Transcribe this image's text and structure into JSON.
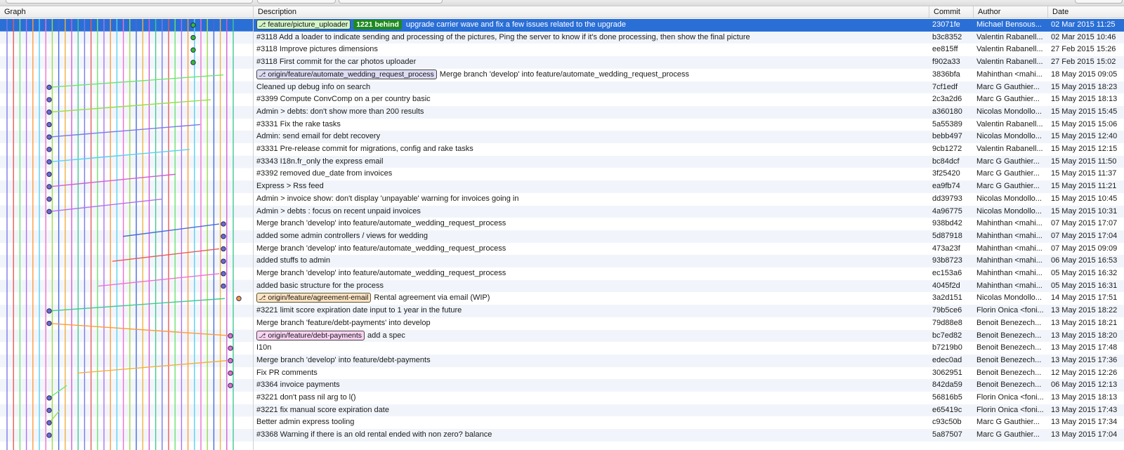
{
  "columns": {
    "graph": "Graph",
    "description": "Description",
    "commit": "Commit",
    "author": "Author",
    "date": "Date"
  },
  "colors": {
    "selected_row": "#2a6fd6",
    "behind_badge": "#1f8a1f",
    "lanes": [
      "#7a7ae8",
      "#e85a5a",
      "#6fe36f",
      "#b070f0",
      "#ff9a3c",
      "#5ad0f0",
      "#f070d0",
      "#9adc4a",
      "#4a6ad8",
      "#f0b040",
      "#d060d0",
      "#40c890"
    ]
  },
  "commits": [
    {
      "refs": [
        {
          "label": "feature/picture_uploader",
          "style": "green"
        }
      ],
      "badge": "1221 behind",
      "message": "upgrade carrier wave and fix a few issues related to the upgrade",
      "hash": "23071fe",
      "author": "Michael Bensous...",
      "date": "02 Mar 2015 11:25",
      "selected": true
    },
    {
      "refs": [],
      "message": "#3118 Add a loader to indicate sending and processing of the pictures, Ping the server to know if it's done processing, then show the final picture",
      "hash": "b3c8352",
      "author": "Valentin Rabanell...",
      "date": "02 Mar 2015 10:46"
    },
    {
      "refs": [],
      "message": "#3118 Improve pictures dimensions",
      "hash": "ee815ff",
      "author": "Valentin Rabanell...",
      "date": "27 Feb 2015 15:26"
    },
    {
      "refs": [],
      "message": "#3118 First commit for the car photos uploader",
      "hash": "f902a33",
      "author": "Valentin Rabanell...",
      "date": "27 Feb 2015 15:02"
    },
    {
      "refs": [
        {
          "label": "origin/feature/automate_wedding_request_process",
          "style": "purple"
        }
      ],
      "message": "Merge branch 'develop' into feature/automate_wedding_request_process",
      "hash": "3836bfa",
      "author": "Mahinthan <mahi...",
      "date": "18 May 2015 09:05"
    },
    {
      "refs": [],
      "message": "Cleaned up debug info on search",
      "hash": "7cf1edf",
      "author": "Marc G Gauthier...",
      "date": "15 May 2015 18:23"
    },
    {
      "refs": [],
      "message": "#3399 Compute ConvComp on a per country basic",
      "hash": "2c3a2d6",
      "author": "Marc G Gauthier...",
      "date": "15 May 2015 18:13"
    },
    {
      "refs": [],
      "message": "Admin > debts: don't show more than 200 results",
      "hash": "a360180",
      "author": "Nicolas Mondollo...",
      "date": "15 May 2015 15:45"
    },
    {
      "refs": [],
      "message": "#3331 Fix the rake tasks",
      "hash": "5a55389",
      "author": "Valentin Rabanell...",
      "date": "15 May 2015 15:06"
    },
    {
      "refs": [],
      "message": "Admin: send email for debt recovery",
      "hash": "bebb497",
      "author": "Nicolas Mondollo...",
      "date": "15 May 2015 12:40"
    },
    {
      "refs": [],
      "message": "#3331 Pre-release commit for migrations, config and rake tasks",
      "hash": "9cb1272",
      "author": "Valentin Rabanell...",
      "date": "15 May 2015 12:15"
    },
    {
      "refs": [],
      "message": "#3343 I18n.fr_only the express email",
      "hash": "bc84dcf",
      "author": "Marc G Gauthier...",
      "date": "15 May 2015 11:50"
    },
    {
      "refs": [],
      "message": "#3392 removed due_date from invoices",
      "hash": "3f25420",
      "author": "Marc G Gauthier...",
      "date": "15 May 2015 11:37"
    },
    {
      "refs": [],
      "message": "Express > Rss feed",
      "hash": "ea9fb74",
      "author": "Marc G Gauthier...",
      "date": "15 May 2015 11:21"
    },
    {
      "refs": [],
      "message": "Admin > invoice show: don't display 'unpayable' warning for invoices going in",
      "hash": "dd39793",
      "author": "Nicolas Mondollo...",
      "date": "15 May 2015 10:45"
    },
    {
      "refs": [],
      "message": "Admin > debts : focus on recent unpaid invoices",
      "hash": "4a96775",
      "author": "Nicolas Mondollo...",
      "date": "15 May 2015 10:31"
    },
    {
      "refs": [],
      "message": "Merge branch 'develop' into feature/automate_wedding_request_process",
      "hash": "938bd42",
      "author": "Mahinthan <mahi...",
      "date": "07 May 2015 17:07"
    },
    {
      "refs": [],
      "message": "added some admin controllers / views for wedding",
      "hash": "5d87918",
      "author": "Mahinthan <mahi...",
      "date": "07 May 2015 17:04"
    },
    {
      "refs": [],
      "message": "Merge branch 'develop' into feature/automate_wedding_request_process",
      "hash": "473a23f",
      "author": "Mahinthan <mahi...",
      "date": "07 May 2015 09:09"
    },
    {
      "refs": [],
      "message": "added stuffs to admin",
      "hash": "93b8723",
      "author": "Mahinthan <mahi...",
      "date": "06 May 2015 16:53"
    },
    {
      "refs": [],
      "message": "Merge branch 'develop' into feature/automate_wedding_request_process",
      "hash": "ec153a6",
      "author": "Mahinthan <mahi...",
      "date": "05 May 2015 16:32"
    },
    {
      "refs": [],
      "message": "added basic structure for the process",
      "hash": "4045f2d",
      "author": "Mahinthan <mahi...",
      "date": "05 May 2015 16:31"
    },
    {
      "refs": [
        {
          "label": "origin/feature/agreement-email",
          "style": "orange"
        }
      ],
      "message": "Rental agreement via email (WIP)",
      "hash": "3a2d151",
      "author": "Nicolas Mondollo...",
      "date": "14 May 2015 17:51"
    },
    {
      "refs": [],
      "message": "#3221 limit score expiration date input to 1 year in the future",
      "hash": "79b5ce6",
      "author": "Florin Onica <foni...",
      "date": "13 May 2015 18:22"
    },
    {
      "refs": [],
      "message": "Merge branch 'feature/debt-payments' into develop",
      "hash": "79d88e8",
      "author": "Benoit Benezech...",
      "date": "13 May 2015 18:21"
    },
    {
      "refs": [
        {
          "label": "origin/feature/debt-payments",
          "style": "pink"
        }
      ],
      "message": "add a spec",
      "hash": "bc7ed82",
      "author": "Benoit Benezech...",
      "date": "13 May 2015 18:20"
    },
    {
      "refs": [],
      "message": "I10n",
      "hash": "b7219b0",
      "author": "Benoit Benezech...",
      "date": "13 May 2015 17:48"
    },
    {
      "refs": [],
      "message": "Merge branch 'develop' into feature/debt-payments",
      "hash": "edec0ad",
      "author": "Benoit Benezech...",
      "date": "13 May 2015 17:36"
    },
    {
      "refs": [],
      "message": "Fix PR comments",
      "hash": "3062951",
      "author": "Benoit Benezech...",
      "date": "12 May 2015 12:26"
    },
    {
      "refs": [],
      "message": "#3364 invoice payments",
      "hash": "842da59",
      "author": "Benoit Benezech...",
      "date": "06 May 2015 12:13"
    },
    {
      "refs": [],
      "message": "#3221 don't pass nil arg to l()",
      "hash": "56816b5",
      "author": "Florin Onica <foni...",
      "date": "13 May 2015 18:13"
    },
    {
      "refs": [],
      "message": "#3221 fix manual score expiration date",
      "hash": "e65419c",
      "author": "Florin Onica <foni...",
      "date": "13 May 2015 17:43"
    },
    {
      "refs": [],
      "message": "Better admin express tooling",
      "hash": "c93c50b",
      "author": "Marc G Gauthier...",
      "date": "13 May 2015 17:34"
    },
    {
      "refs": [],
      "message": "#3368  Warning if there is an old rental ended with non zero? balance",
      "hash": "5a87507",
      "author": "Marc G Gauthier...",
      "date": "13 May 2015 17:04"
    }
  ]
}
